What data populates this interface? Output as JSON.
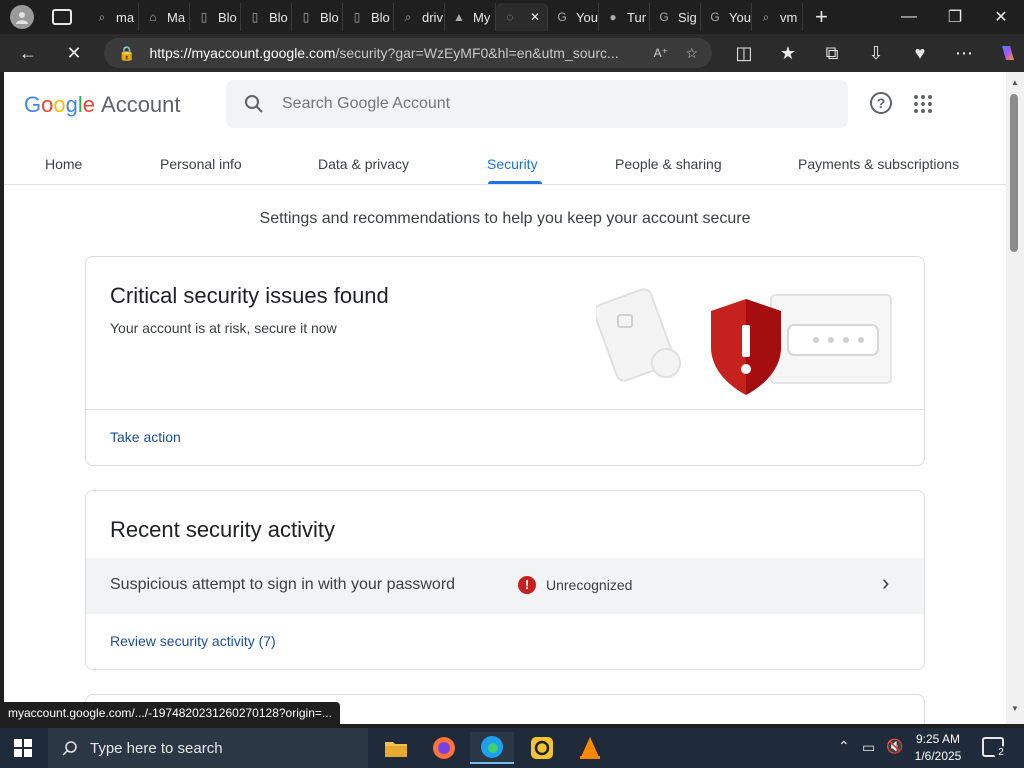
{
  "browser": {
    "tabs": [
      {
        "label": "ma",
        "icon": "search-icon"
      },
      {
        "label": "Ma",
        "icon": "bank-icon"
      },
      {
        "label": "Blo",
        "icon": "document-icon"
      },
      {
        "label": "Blo",
        "icon": "document-icon"
      },
      {
        "label": "Blo",
        "icon": "document-icon"
      },
      {
        "label": "Blo",
        "icon": "document-icon"
      },
      {
        "label": "driv",
        "icon": "search-icon"
      },
      {
        "label": "My",
        "icon": "drive-icon"
      },
      {
        "label": "",
        "icon": "loading-icon"
      },
      {
        "label": "You",
        "icon": "google-icon"
      },
      {
        "label": "Tur",
        "icon": "globe-icon"
      },
      {
        "label": "Sig",
        "icon": "google-icon"
      },
      {
        "label": "You",
        "icon": "google-icon"
      },
      {
        "label": "vm",
        "icon": "search-icon"
      }
    ],
    "url_host": "https://myaccount.google.com",
    "url_rest": "/security?gar=WzEyMF0&hl=en&utm_sourc...",
    "status_url": "myaccount.google.com/.../-197482023126027012​8?origin=..."
  },
  "header": {
    "logo_google": [
      "G",
      "o",
      "o",
      "g",
      "l",
      "e"
    ],
    "logo_colors": [
      "#4285F4",
      "#EA4335",
      "#FBBC05",
      "#4285F4",
      "#34A853",
      "#EA4335"
    ],
    "logo_account": "Account",
    "search_placeholder": "Search Google Account"
  },
  "nav": {
    "tabs": [
      "Home",
      "Personal info",
      "Data & privacy",
      "Security",
      "People & sharing",
      "Payments & subscriptions"
    ],
    "selected": "Security"
  },
  "main": {
    "subtitle": "Settings and recommendations to help you keep your account secure",
    "critical": {
      "title": "Critical security issues found",
      "desc": "Your account is at risk, secure it now",
      "action": "Take action"
    },
    "recent": {
      "title": "Recent security activity",
      "event": "Suspicious attempt to sign in with your password",
      "status": "Unrecognized",
      "review": "Review security activity (7)"
    }
  },
  "taskbar": {
    "search_placeholder": "Type here to search",
    "time": "9:25 AM",
    "date": "1/6/2025",
    "notif_count": "2"
  },
  "colors": {
    "accent": "#1a73e8",
    "danger": "#c5221f"
  }
}
